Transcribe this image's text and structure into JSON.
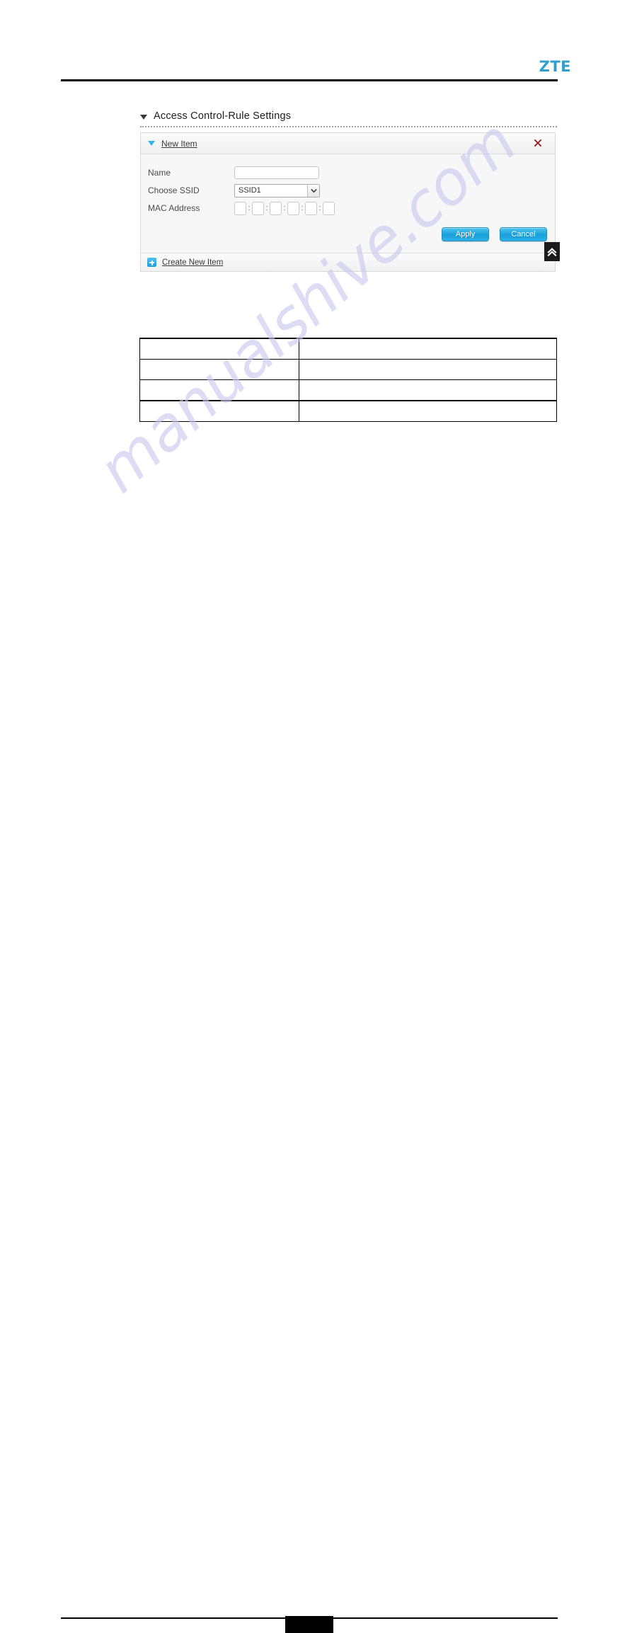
{
  "header": {
    "brand_logo": "ZTE",
    "brand_color": "#2f9fd0"
  },
  "watermark": {
    "text": "manualshive.com",
    "color": "#c8c8ee"
  },
  "section": {
    "title": "Access Control-Rule Settings",
    "caret_icon": "caret-down-icon"
  },
  "panel": {
    "item_header": {
      "caret_icon": "caret-down-icon",
      "title": "New Item",
      "delete_icon": "close-x-icon",
      "delete_color": "#b32020"
    },
    "form": {
      "fields": [
        {
          "label": "Name",
          "type": "text",
          "value": "",
          "placeholder": ""
        },
        {
          "label": "Choose SSID",
          "type": "select",
          "value": "SSID1",
          "options": [
            "SSID1"
          ]
        },
        {
          "label": "MAC Address",
          "type": "mac",
          "separator": ":",
          "octets": [
            "",
            "",
            "",
            "",
            "",
            ""
          ]
        }
      ]
    },
    "actions": {
      "apply_label": "Apply",
      "cancel_label": "Cancel",
      "button_color": "#22a5de"
    },
    "footer": {
      "create_icon": "plus-square-icon",
      "create_label": "Create New Item"
    }
  },
  "scroll_top": {
    "icon": "double-chevron-up-icon"
  },
  "info_table": {
    "columns": [
      "",
      ""
    ],
    "rows": [
      [
        "",
        ""
      ],
      [
        "",
        ""
      ],
      [
        "",
        ""
      ],
      [
        "",
        ""
      ]
    ]
  },
  "footer": {
    "page_number_redacted": true
  }
}
